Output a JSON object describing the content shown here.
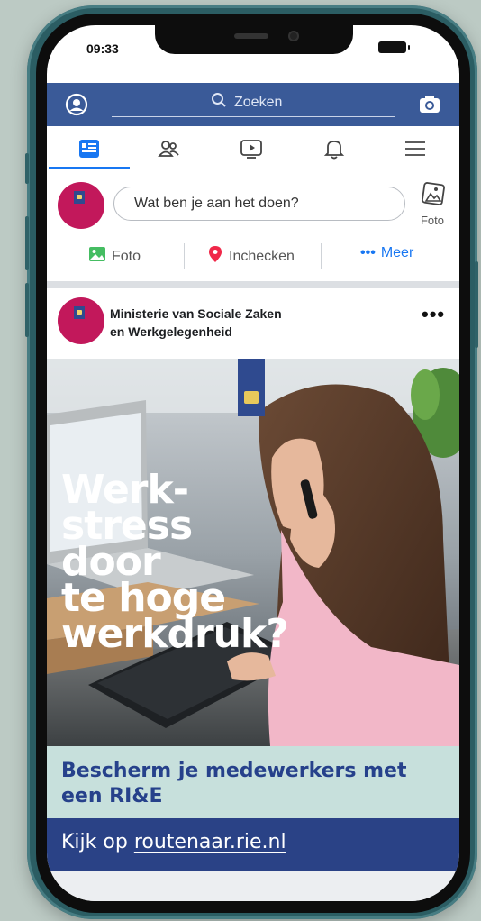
{
  "status": {
    "time": "09:33"
  },
  "header": {
    "search_placeholder": "Zoeken"
  },
  "nav": {
    "items": [
      "home-feed",
      "friends",
      "watch",
      "notifications",
      "menu"
    ],
    "active_color": "#1877f2"
  },
  "composer": {
    "prompt": "Wat ben je aan het doen?",
    "photo_label": "Foto",
    "actions": [
      {
        "label": "Foto",
        "icon": "photo-icon",
        "color": "#45bd62"
      },
      {
        "label": "Inchecken",
        "icon": "location-pin-icon",
        "color": "#f02849"
      },
      {
        "label": "Meer",
        "icon": "more-dots-icon",
        "color": "#1877f2"
      }
    ]
  },
  "post": {
    "author_line1": "Ministerie van Sociale Zaken",
    "author_line2": "en Werkgelegenheid",
    "more": "•••",
    "headline": [
      "Werk-",
      "stress",
      "door",
      "te hoge",
      "werkdruk?"
    ],
    "tagline": "Bescherm je medewerkers met een RI&E",
    "cta_prefix": "Kijk op ",
    "cta_link": "routenaar.rie.nl"
  },
  "colors": {
    "header_bg": "#3a5a98",
    "avatar_bg": "#c2185b",
    "tagline_bg": "#c7e0dc",
    "tagline_text": "#26418b",
    "cta_bg": "#2a4286",
    "phone_frame": "#2b5d63"
  }
}
